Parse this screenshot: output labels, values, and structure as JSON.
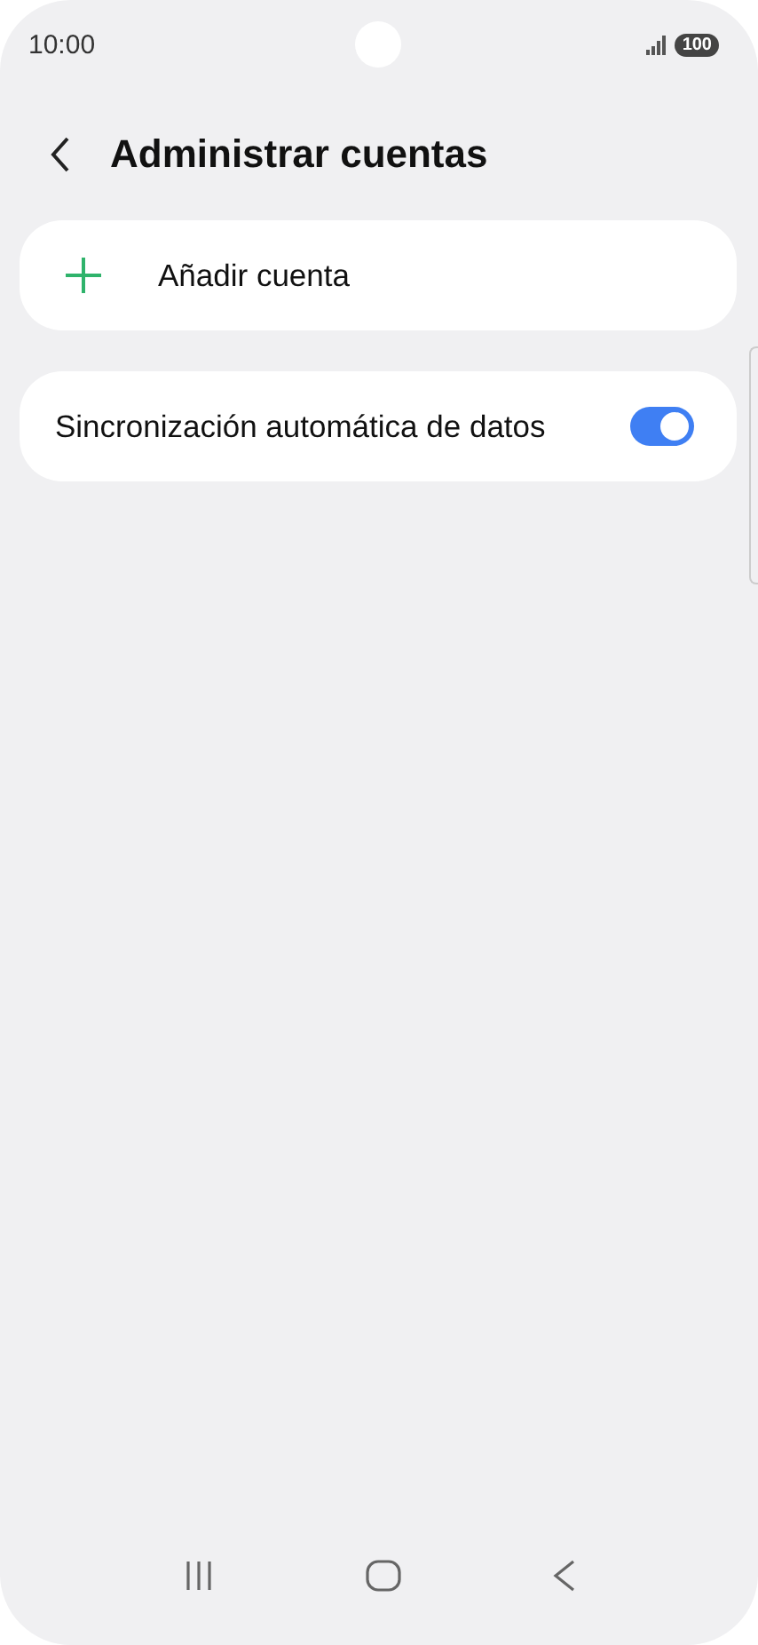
{
  "status_bar": {
    "time": "10:00",
    "battery": "100"
  },
  "header": {
    "title": "Administrar cuentas"
  },
  "items": [
    {
      "kind": "action",
      "label": "Añadir cuenta"
    },
    {
      "kind": "toggle",
      "label": "Sincronización automática de datos",
      "on": true
    }
  ]
}
